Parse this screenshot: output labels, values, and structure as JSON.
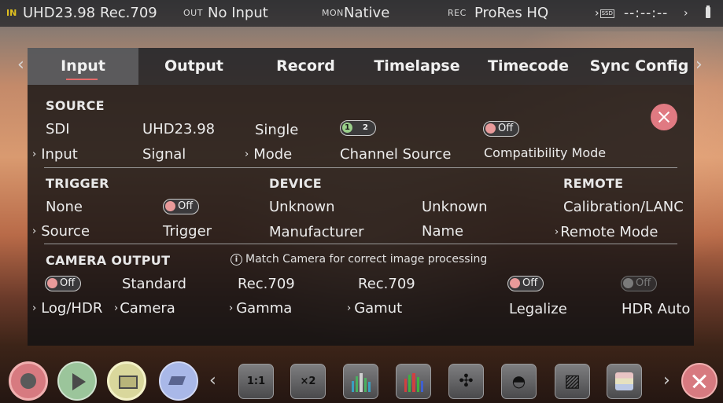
{
  "topbar": {
    "in_label": "IN",
    "input_format": "UHD23.98",
    "input_colorspace": "Rec.709",
    "out_label": "OUT",
    "out_value": "No Input",
    "mon_label": "MON",
    "mon_value": "Native",
    "rec_label": "REC",
    "rec_value": "ProRes HQ",
    "ssd_label": "SSD",
    "timecode": "--:--:--"
  },
  "tabs": [
    {
      "label": "Input",
      "active": true
    },
    {
      "label": "Output"
    },
    {
      "label": "Record"
    },
    {
      "label": "Timelapse"
    },
    {
      "label": "Timecode"
    },
    {
      "label": "Sync Config"
    }
  ],
  "source": {
    "title": "SOURCE",
    "input_value": "SDI",
    "input_label": "Input",
    "signal_value": "UHD23.98",
    "signal_label": "Signal",
    "mode_value": "Single",
    "mode_label": "Mode",
    "channel_options": [
      "1",
      "2"
    ],
    "channel_label": "Channel Source",
    "compat_toggle": "Off",
    "compat_label": "Compatibility Mode"
  },
  "trigger": {
    "title": "TRIGGER",
    "source_value": "None",
    "source_label": "Source",
    "trigger_toggle": "Off",
    "trigger_label": "Trigger"
  },
  "device": {
    "title": "DEVICE",
    "manufacturer_value": "Unknown",
    "manufacturer_label": "Manufacturer",
    "name_value": "Unknown",
    "name_label": "Name"
  },
  "remote": {
    "title": "REMOTE",
    "mode_value": "Calibration/LANC",
    "mode_label": "Remote Mode"
  },
  "camera_output": {
    "title": "CAMERA OUTPUT",
    "note": "Match Camera for correct image processing",
    "loghdr_toggle": "Off",
    "loghdr_label": "Log/HDR",
    "camera_value": "Standard",
    "camera_label": "Camera",
    "gamma_value": "Rec.709",
    "gamma_label": "Gamma",
    "gamut_value": "Rec.709",
    "gamut_label": "Gamut",
    "legalize_toggle": "Off",
    "legalize_label": "Legalize",
    "hdrauto_toggle": "Off",
    "hdrauto_label": "HDR Auto"
  },
  "toolbar": {
    "zoom_1to1": "1:1",
    "zoom_x2": "×2",
    "icons": [
      "record-icon",
      "play-icon",
      "monitor-icon",
      "tag-icon",
      "zoom-1to1-icon",
      "zoom-x2-icon",
      "waveform-icon",
      "vectorscope-icon",
      "focus-peaking-icon",
      "false-color-icon",
      "zebra-icon",
      "lut-icon",
      "close-icon"
    ]
  }
}
